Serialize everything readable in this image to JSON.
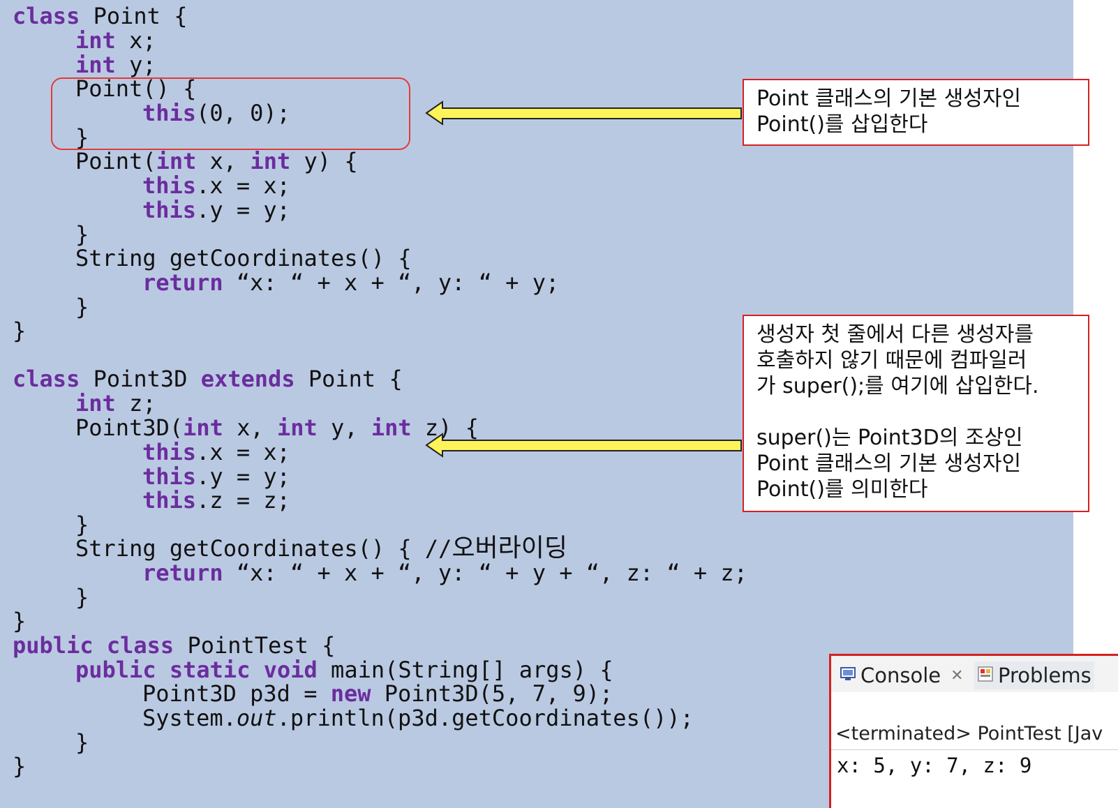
{
  "code": {
    "line1": {
      "kw": "class",
      "rest": " Point {"
    },
    "line2": {
      "kw": "int",
      "rest": " x;"
    },
    "line3": {
      "kw": "int",
      "rest": " y;"
    },
    "line4": {
      "text": "Point() {"
    },
    "line5": {
      "kw": "this",
      "rest": "(0, 0);"
    },
    "line6": {
      "text": "}"
    },
    "line7": {
      "a": "Point(",
      "kw1": "int",
      "b": " x, ",
      "kw2": "int",
      "c": " y) {"
    },
    "line8": {
      "kw": "this",
      "rest": ".x = x;"
    },
    "line9": {
      "kw": "this",
      "rest": ".y = y;"
    },
    "line10": {
      "text": "}"
    },
    "line11": {
      "text": "String getCoordinates() {"
    },
    "line12": {
      "kw": "return",
      "rest": " “x: “ + x + “, y: “ + y;"
    },
    "line13": {
      "text": "}"
    },
    "line14": {
      "text": "}"
    },
    "line15": {
      "kw1": "class",
      "a": " Point3D ",
      "kw2": "extends",
      "b": " Point {"
    },
    "line16": {
      "kw": "int",
      "rest": " z;"
    },
    "line17": {
      "a": "Point3D(",
      "kw1": "int",
      "b": " x, ",
      "kw2": "int",
      "c": " y, ",
      "kw3": "int",
      "d": " z) {"
    },
    "line18": {
      "kw": "this",
      "rest": ".x = x;"
    },
    "line19": {
      "kw": "this",
      "rest": ".y = y;"
    },
    "line20": {
      "kw": "this",
      "rest": ".z = z;"
    },
    "line21": {
      "text": "}"
    },
    "line22": {
      "a": "String getCoordinates() { //",
      "comment": "오버라이딩"
    },
    "line23": {
      "kw": "return",
      "rest": " “x: “ + x + “, y: “ + y + “, z: “ + z;"
    },
    "line24": {
      "text": "}"
    },
    "line25": {
      "text": "}"
    },
    "line26": {
      "kw1": "public",
      "a": " ",
      "kw2": "class",
      "b": " PointTest {"
    },
    "line27": {
      "kw1": "public",
      "a": " ",
      "kw2": "static",
      "b": " ",
      "kw3": "void",
      "c": " main(String[] args) {"
    },
    "line28": {
      "a": "Point3D p3d = ",
      "kw": "new",
      "b": " Point3D(5, 7, 9);"
    },
    "line29": {
      "a": "System.",
      "italic": "out",
      "b": ".println(p3d.getCoordinates());"
    },
    "line30": {
      "text": "}"
    },
    "line31": {
      "text": "}"
    }
  },
  "callout1": {
    "line1": "Point 클래스의 기본 생성자인",
    "line2": "Point()를 삽입한다"
  },
  "callout2": {
    "line1": "생성자 첫 줄에서 다른 생성자를",
    "line2": "호출하지 않기 때문에 컴파일러",
    "line3": "가 super();를 여기에 삽입한다.",
    "line4": "super()는 Point3D의 조상인",
    "line5": "Point 클래스의 기본 생성자인",
    "line6": "Point()를 의미한다"
  },
  "console": {
    "tab_console": "Console",
    "tab_problems": "Problems",
    "status": "<terminated> PointTest [Jav",
    "output": "x: 5, y: 7, z: 9"
  },
  "colors": {
    "background": "#bac9e2",
    "keyword": "#6b2d9e",
    "arrow_fill": "#fff35a",
    "callout_border": "#d62020"
  }
}
